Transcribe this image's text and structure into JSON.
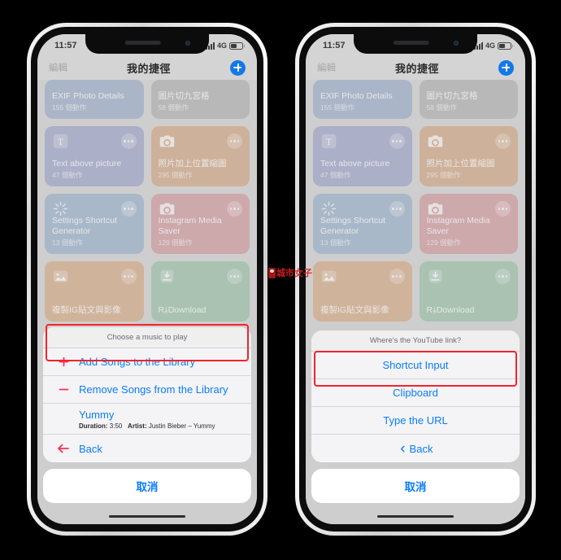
{
  "watermark": {
    "text": "城市女子"
  },
  "status_bar": {
    "time": "11:57",
    "network": "4G"
  },
  "navbar": {
    "edit": "編輯",
    "title": "我的捷徑",
    "add_icon": "plus-circle-icon"
  },
  "shortcuts": [
    {
      "title": "EXIF Photo Details",
      "subtitle": "155 個動作",
      "color": "#93a4c4",
      "icon": ""
    },
    {
      "title": "圖片切九宮格",
      "subtitle": "58 個動作",
      "color": "#a9a9a9",
      "icon": ""
    },
    {
      "title": "Text above picture",
      "subtitle": "47 個動作",
      "color": "#9499c4",
      "icon": "text-icon"
    },
    {
      "title": "照片加上位置縮圖",
      "subtitle": "295 個動作",
      "color": "#cf9e75",
      "icon": "camera-icon"
    },
    {
      "title": "Settings Shortcut Generator",
      "subtitle": "13 個動作",
      "color": "#8fa9c6",
      "icon": "sparkle-icon"
    },
    {
      "title": "Instagram Media Saver",
      "subtitle": "129 個動作",
      "color": "#cd8f93",
      "icon": "camera-icon"
    },
    {
      "title": "複製IG貼文與影像",
      "subtitle": "",
      "color": "#d3a077",
      "icon": "photo-icon"
    },
    {
      "title": "R⤓Download",
      "subtitle": "",
      "color": "#8fba9f",
      "icon": "download-icon"
    }
  ],
  "left_sheet": {
    "header": "Choose a music to play",
    "rows": [
      {
        "label": "Add Songs to the Library",
        "icon": "plus-icon",
        "highlighted": true
      },
      {
        "label": "Remove Songs from the Library",
        "icon": "minus-icon",
        "highlighted": false
      }
    ],
    "detail": {
      "title": "Yummy",
      "duration_label": "Duration:",
      "duration_value": "3:50",
      "artist_label": "Artist:",
      "artist_value": "Justin Bieber – Yummy"
    },
    "back": {
      "label": "Back",
      "icon": "arrow-left-icon"
    },
    "cancel": "取消"
  },
  "right_sheet": {
    "header": "Where's the YouTube link?",
    "rows": [
      {
        "label": "Shortcut Input",
        "highlighted": false
      },
      {
        "label": "Clipboard",
        "highlighted": true
      },
      {
        "label": "Type the URL",
        "highlighted": false
      }
    ],
    "back": {
      "label": "Back",
      "icon": "chevron-left-icon"
    },
    "cancel": "取消"
  },
  "colors": {
    "accent_blue": "#0a7cff",
    "highlight_red": "#f5232b",
    "pink_icon": "#ff2d55",
    "add_button": "#1478e8"
  }
}
